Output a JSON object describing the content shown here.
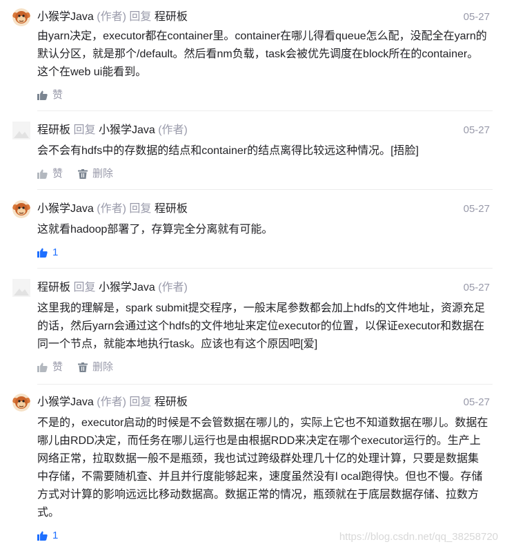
{
  "comments": [
    {
      "author": "小猴学Java",
      "author_tag": "(作者)",
      "reply_word": "回复",
      "reply_to": "程研板",
      "reply_to_tag": "",
      "date": "05-27",
      "text": "由yarn决定，executor都在container里。container在哪儿得看queue怎么配，没配全在yarn的默认分区，就是那个/default。然后看nm负载，task会被优先调度在block所在的container。这个在web ui能看到。",
      "like_label": "赞",
      "delete_label": ""
    },
    {
      "author": "程研板",
      "author_tag": "",
      "reply_word": "回复",
      "reply_to": "小猴学Java",
      "reply_to_tag": "(作者)",
      "date": "05-27",
      "text": "会不会有hdfs中的存数据的结点和container的结点离得比较远这种情况。[捂脸]",
      "like_label": "赞",
      "delete_label": "删除"
    },
    {
      "author": "小猴学Java",
      "author_tag": "(作者)",
      "reply_word": "回复",
      "reply_to": "程研板",
      "reply_to_tag": "",
      "date": "05-27",
      "text": "这就看hadoop部署了，存算完全分离就有可能。",
      "like_label": "1",
      "delete_label": ""
    },
    {
      "author": "程研板",
      "author_tag": "",
      "reply_word": "回复",
      "reply_to": "小猴学Java",
      "reply_to_tag": "(作者)",
      "date": "05-27",
      "text": "这里我的理解是，spark submit提交程序，一般末尾参数都会加上hdfs的文件地址，资源充足的话，然后yarn会通过这个hdfs的文件地址来定位executor的位置，以保证executor和数据在同一个节点，就能本地执行task。应该也有这个原因吧[爱]",
      "like_label": "赞",
      "delete_label": "删除"
    },
    {
      "author": "小猴学Java",
      "author_tag": "(作者)",
      "reply_word": "回复",
      "reply_to": "程研板",
      "reply_to_tag": "",
      "date": "05-27",
      "text": "不是的，executor启动的时候是不会管数据在哪儿的，实际上它也不知道数据在哪儿。数据在哪儿由RDD决定，而任务在哪儿运行也是由根据RDD来决定在哪个executor运行的。生产上网络正常，拉取数据一般不是瓶颈，我也试过跨级群处理几十亿的处理计算，只要是数据集中存储，不需要随机查、并且并行度能够起来，速度虽然没有l ocal跑得快。但也不慢。存储方式对计算的影响远远比移动数据高。数据正常的情况，瓶颈就在于底层数据存储、拉数方式。",
      "like_label": "1",
      "delete_label": ""
    }
  ],
  "watermark": "https://blog.csdn.net/qq_38258720",
  "colors": {
    "muted": "#999aaa",
    "text": "#222226",
    "liked": "#1e6fff",
    "divider": "#ececec"
  },
  "icons": {
    "author_avatar": "monkey-avatar-icon",
    "user_avatar": "blank-avatar-icon",
    "like": "thumbs-up-icon",
    "delete": "trash-icon"
  }
}
